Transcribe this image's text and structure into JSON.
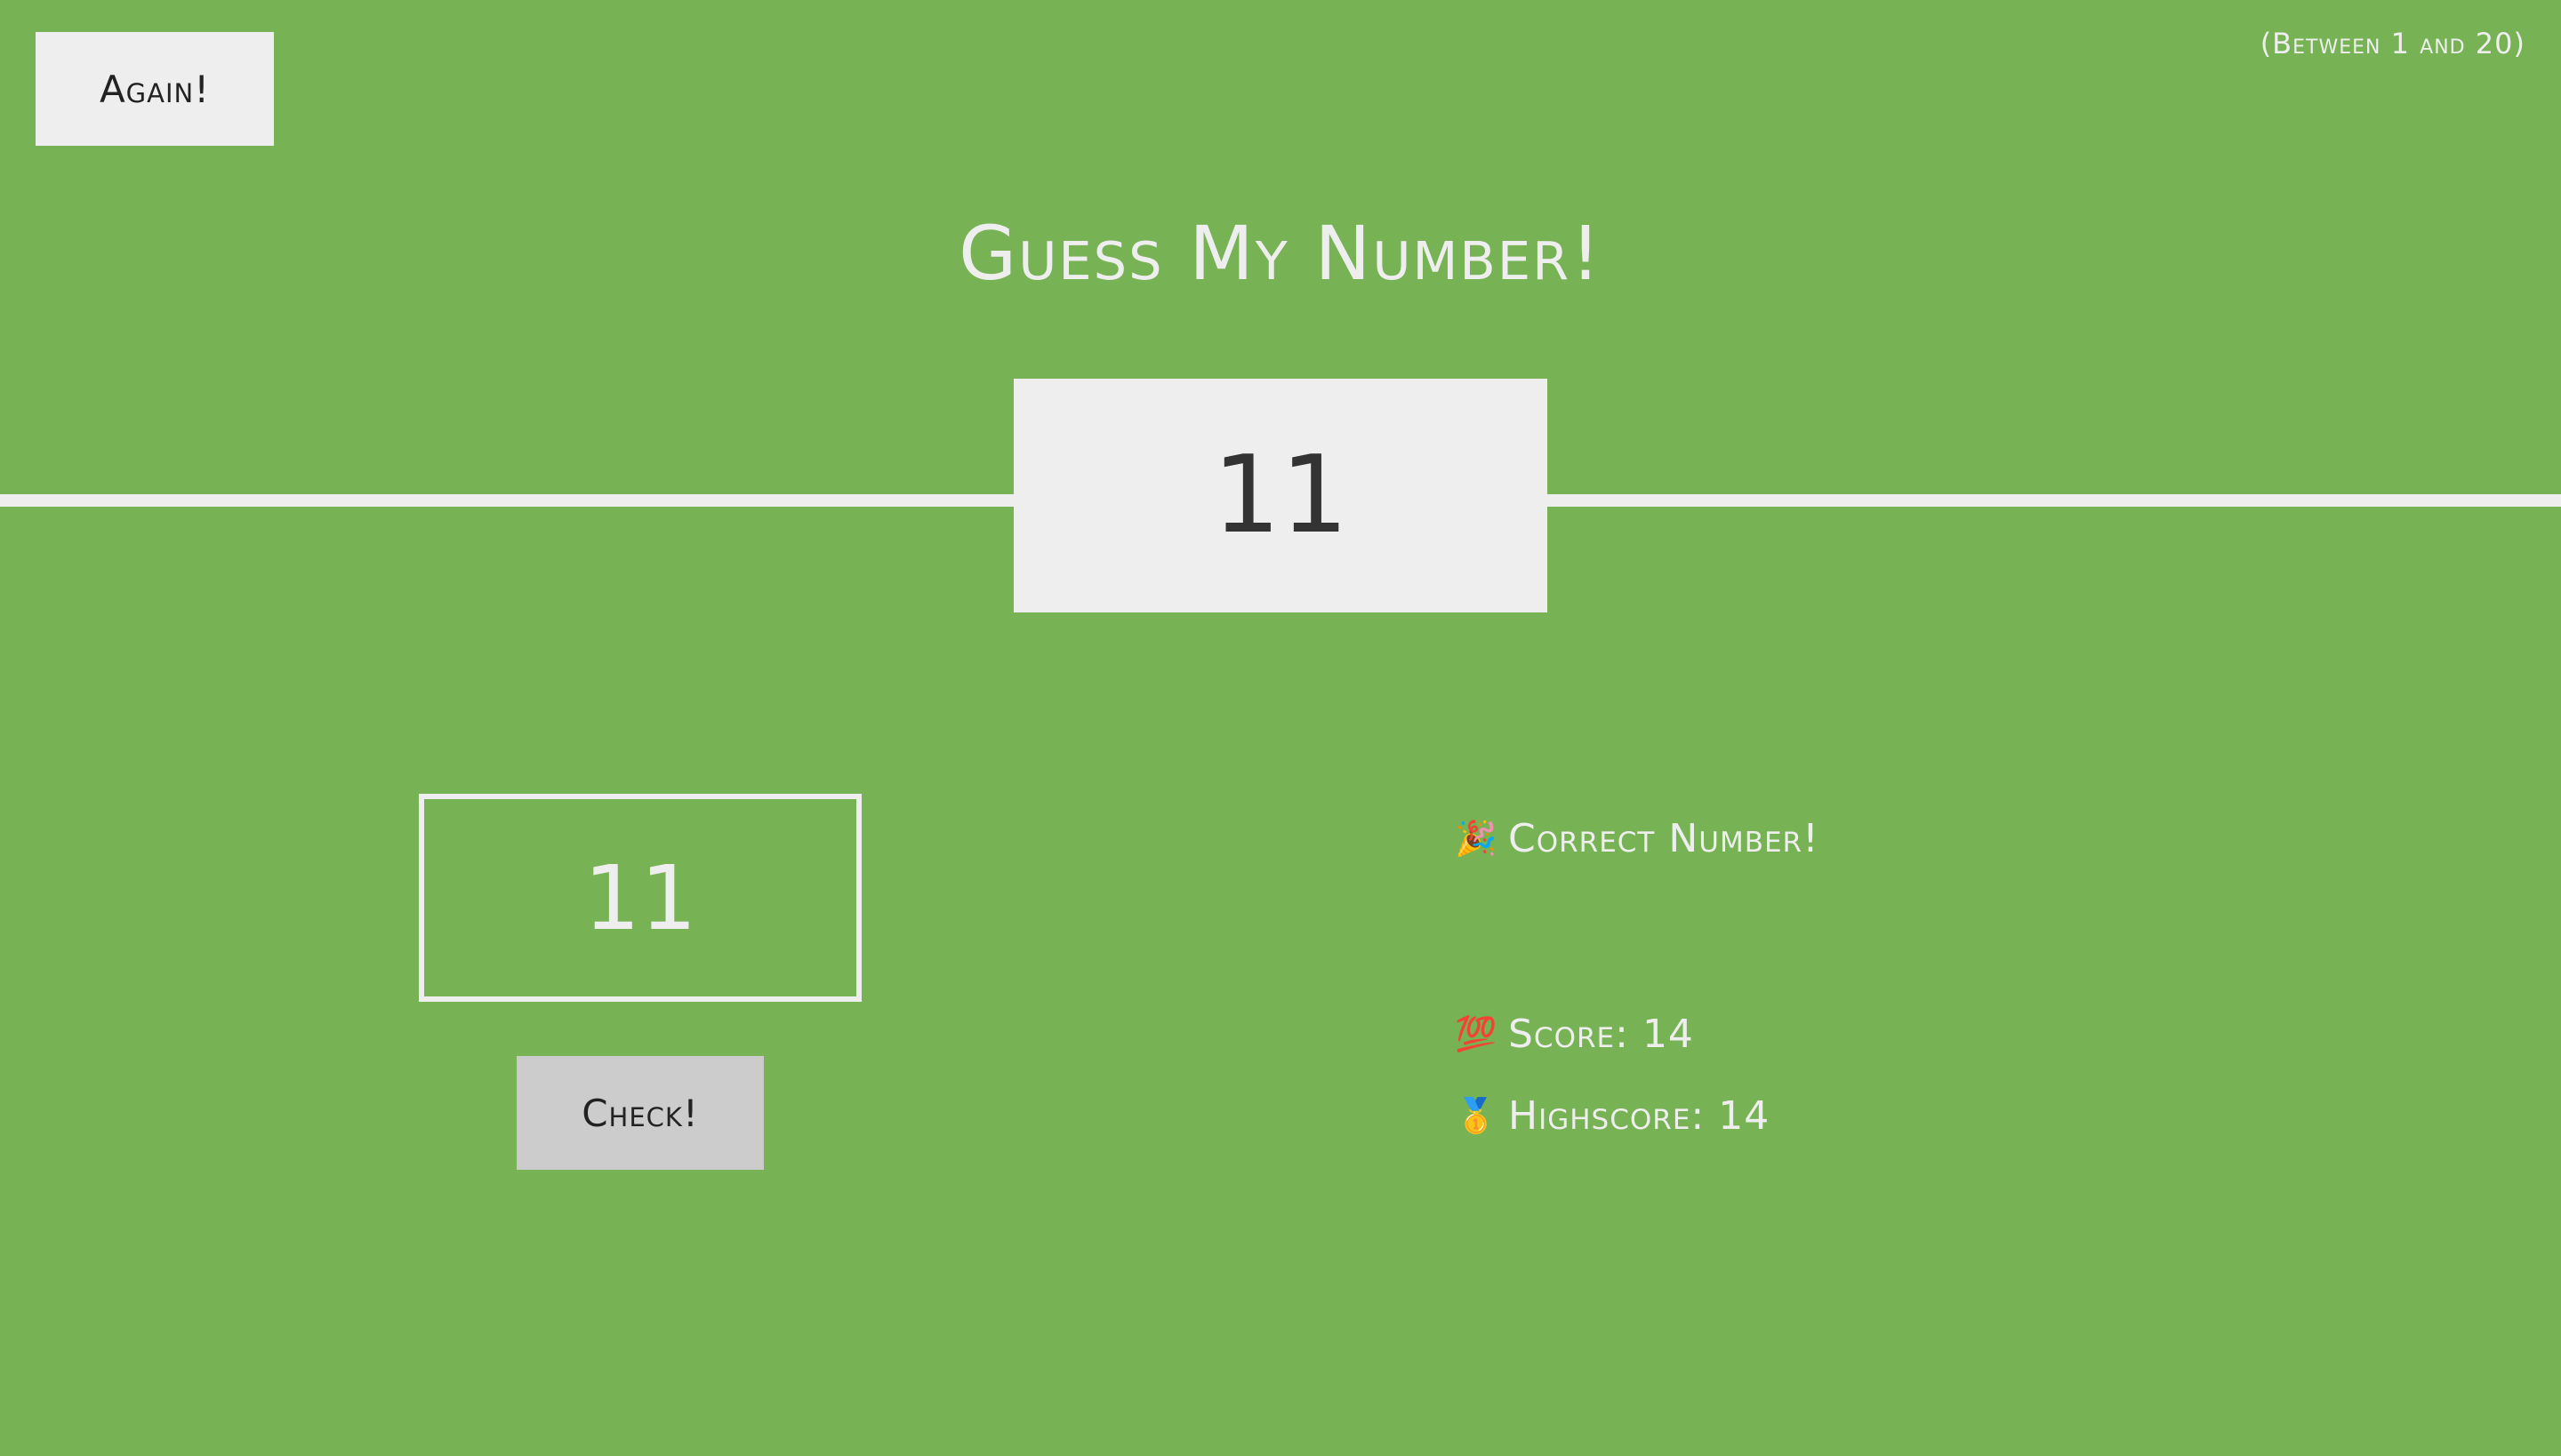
{
  "header": {
    "again_label": "Again!",
    "range_hint": "(Between 1 and 20)",
    "title": "Guess My Number!"
  },
  "secret_number": "11",
  "guess": {
    "value": "11"
  },
  "check_label": "Check!",
  "message": {
    "icon": "party-popper-icon",
    "emoji": "🎉",
    "text": "Correct Number!"
  },
  "score": {
    "icon": "hundred-points-icon",
    "emoji": "💯",
    "label": "Score:",
    "value": "14"
  },
  "highscore": {
    "icon": "medal-icon",
    "emoji": "🥇",
    "label": "Highscore:",
    "value": "14"
  },
  "colors": {
    "background": "#77b255",
    "light": "#eeeeee",
    "dark_text": "#333333",
    "check_button": "#cccccc"
  }
}
